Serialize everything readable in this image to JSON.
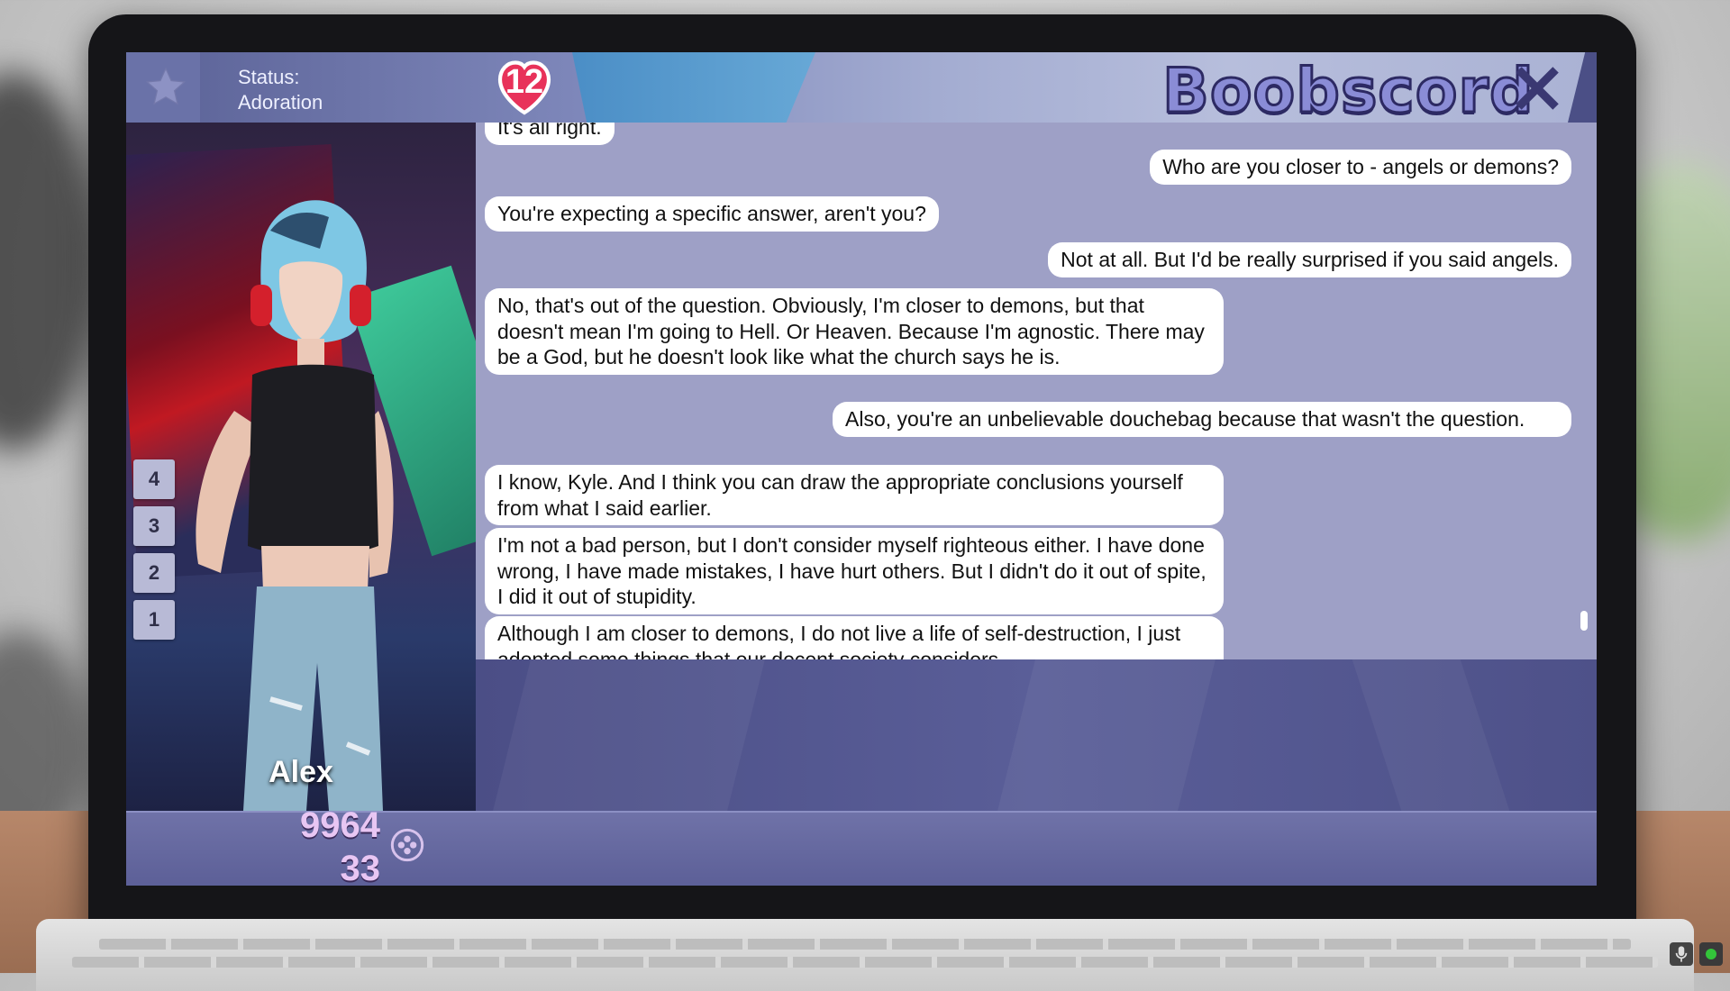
{
  "header": {
    "status_label": "Status:",
    "status_value": "Adoration",
    "heart_count": "12",
    "app_title": "Boobscord"
  },
  "character": {
    "name": "Alex",
    "levels": [
      "4",
      "3",
      "2",
      "1"
    ]
  },
  "scores": {
    "primary": "9964",
    "secondary": "33"
  },
  "messages": [
    {
      "side": "left",
      "text": "It's all right."
    },
    {
      "side": "right",
      "text": "Who are you closer to - angels or demons?"
    },
    {
      "side": "left",
      "text": "You're expecting a specific answer, aren't you?"
    },
    {
      "side": "right",
      "text": "Not at all. But I'd be really surprised if you said angels."
    },
    {
      "side": "left",
      "text": "No, that's out of the question. Obviously, I'm closer to demons, but that doesn't mean I'm going to Hell. Or Heaven. Because I'm agnostic. There may be a God, but he doesn't look like what the church says he is."
    },
    {
      "side": "right",
      "text": "Also, you're an unbelievable douchebag because that wasn't the question."
    },
    {
      "side": "left",
      "text": "I know, Kyle. And I think you can draw the appropriate conclusions yourself from what I said earlier."
    },
    {
      "side": "left",
      "text": "I'm not a bad person, but I don't consider myself righteous either. I have done wrong, I have made mistakes, I have hurt others. But I didn't do it out of spite, I did it out of stupidity."
    },
    {
      "side": "left",
      "text": "Although I am closer to demons, I do not live a life of self-destruction, I just adopted some things that our decent society considers"
    }
  ],
  "colors": {
    "accent": "#8a8cd6",
    "heart": "#e8325a",
    "chat_bg": "#9ea0c6",
    "status_green": "#33c43a"
  },
  "icons": [
    "star-icon",
    "heart-icon",
    "close-icon",
    "gamepad-icon",
    "mic-icon"
  ]
}
